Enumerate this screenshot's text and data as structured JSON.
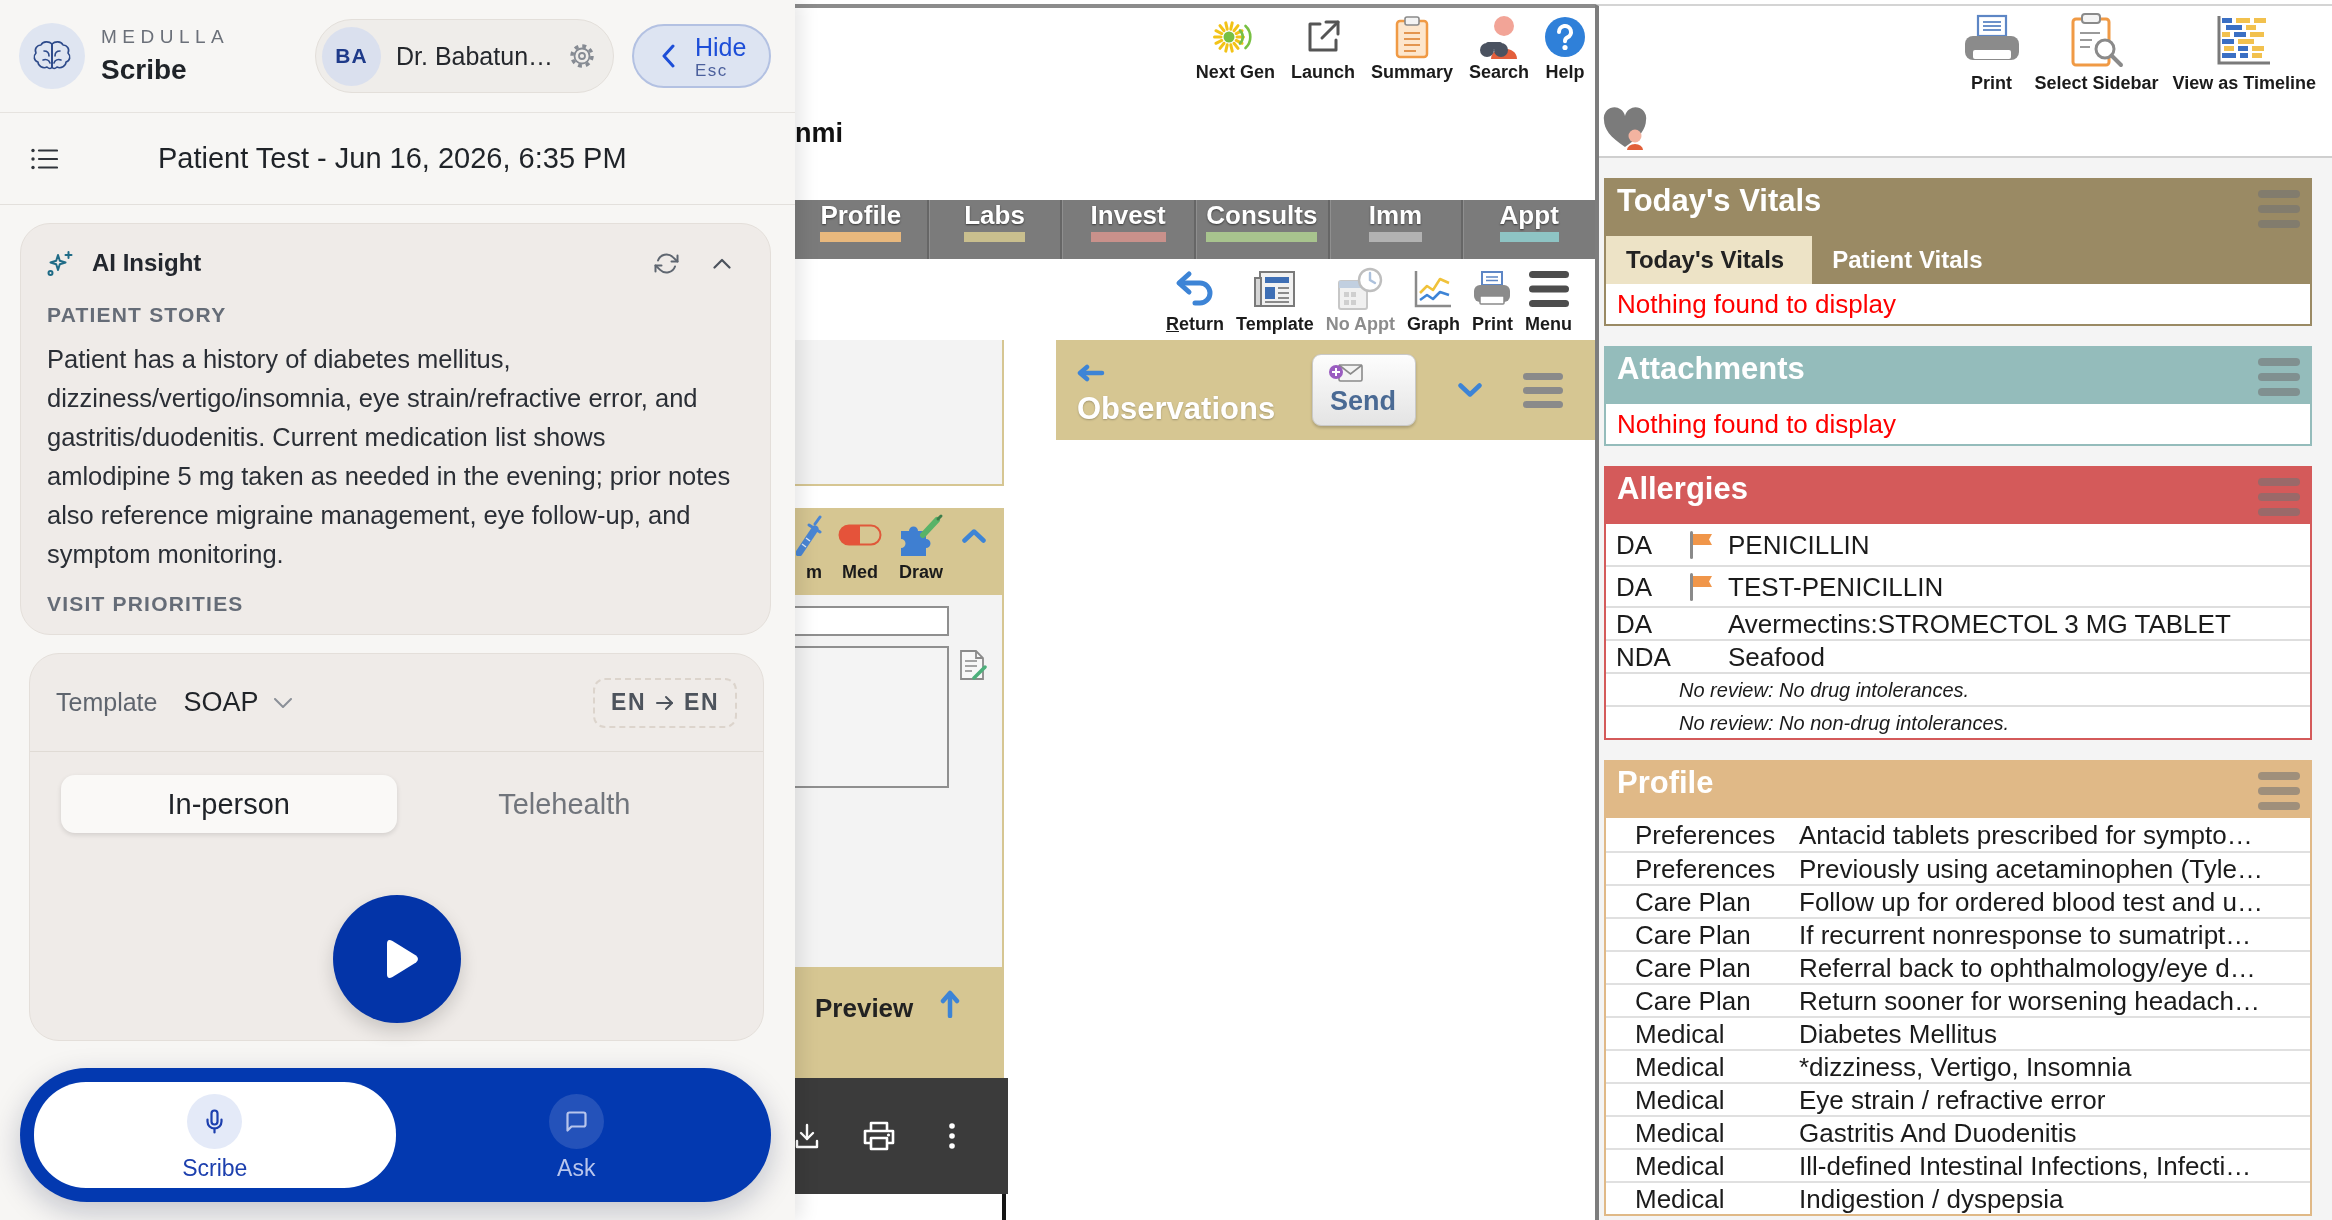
{
  "scribe": {
    "brand": {
      "company": "MEDULLA",
      "product": "Scribe"
    },
    "user": {
      "initials": "BA",
      "name": "Dr. Babatun…"
    },
    "hide_button": {
      "label": "Hide",
      "shortcut": "Esc"
    },
    "session_title": "Patient Test - Jun 16, 2026, 6:35 PM",
    "insight": {
      "title": "AI Insight",
      "expanded": true,
      "sections": [
        {
          "heading": "PATIENT STORY",
          "text": "Patient has a history of diabetes mellitus, dizziness/vertigo/insomnia, eye strain/refractive error, and gastritis/duodenitis. Current medication list shows amlodipine 5 mg taken as needed in the evening; prior notes also reference migraine management, eye follow-up, and symptom monitoring."
        },
        {
          "heading": "VISIT PRIORITIES"
        }
      ]
    },
    "recorder": {
      "template_label": "Template",
      "template": "SOAP",
      "source_language": "EN",
      "target_language": "EN",
      "modes": [
        {
          "label": "In-person",
          "selected": true
        },
        {
          "label": "Telehealth",
          "selected": false
        }
      ]
    },
    "nav": [
      {
        "label": "Scribe",
        "selected": true
      },
      {
        "label": "Ask",
        "selected": false
      }
    ]
  },
  "emr": {
    "header_tools": [
      "Next Gen",
      "Launch",
      "Summary",
      "Search",
      "Help"
    ],
    "patient_name": "nmi",
    "tabs": [
      {
        "label": "Profile",
        "color": "#e8b87d",
        "selected": false
      },
      {
        "label": "Labs",
        "color": "#c9bf8e",
        "selected": false
      },
      {
        "label": "Invest",
        "color": "#c9918b",
        "selected": false
      },
      {
        "label": "Consults",
        "color": "#a8c48e",
        "selected": false
      },
      {
        "label": "Imm",
        "color": "#b2b2b2",
        "selected": false
      },
      {
        "label": "Appt",
        "color": "#8ec4c4",
        "selected": false
      }
    ],
    "toolbar": [
      {
        "label": "Return",
        "disabled": false,
        "access_key": true
      },
      {
        "label": "Template",
        "disabled": false,
        "access_key": false
      },
      {
        "label": "No Appt",
        "disabled": true,
        "access_key": false
      },
      {
        "label": "Graph",
        "disabled": false,
        "access_key": false
      },
      {
        "label": "Print",
        "disabled": false,
        "access_key": false
      },
      {
        "label": "Menu",
        "disabled": false,
        "access_key": false
      }
    ],
    "clinical_tools": [
      "m",
      "Med",
      "Draw"
    ],
    "preview": {
      "title": "Preview"
    },
    "observations": {
      "title": "Observations",
      "send_label": "Send"
    }
  },
  "sidebar": {
    "tools": [
      "Print",
      "Select Sidebar",
      "View as Timeline"
    ],
    "panels": [
      {
        "kind": "vitals",
        "title": "Today's Vitals",
        "color": "#9a8a64",
        "tabs": [
          {
            "label": "Today's Vitals",
            "selected": true
          },
          {
            "label": "Patient Vitals",
            "selected": false
          }
        ],
        "empty_message": "Nothing found to display"
      },
      {
        "kind": "attachments",
        "title": "Attachments",
        "color": "#94bcbb",
        "empty_message": "Nothing found to display"
      },
      {
        "kind": "allergies",
        "title": "Allergies",
        "color": "#d45a5a",
        "rows": [
          {
            "type": "DA",
            "flagged": true,
            "name": "PENICILLIN"
          },
          {
            "type": "DA",
            "flagged": true,
            "name": "TEST-PENICILLIN"
          },
          {
            "type": "DA",
            "flagged": false,
            "name": "Avermectins:STROMECTOL 3 MG TABLET"
          },
          {
            "type": "NDA",
            "flagged": false,
            "name": "Seafood"
          }
        ],
        "notes": [
          "No review: No drug intolerances.",
          "No review: No non-drug intolerances."
        ]
      },
      {
        "kind": "profile",
        "title": "Profile",
        "color": "#e0b987",
        "rows": [
          {
            "category": "Preferences",
            "description": "Antacid tablets prescribed for sympto…"
          },
          {
            "category": "Preferences",
            "description": "Previously using acetaminophen (Tyle…"
          },
          {
            "category": "Care Plan",
            "description": "Follow up for ordered blood test and u…"
          },
          {
            "category": "Care Plan",
            "description": "If recurrent nonresponse to sumatript…"
          },
          {
            "category": "Care Plan",
            "description": "Referral back to ophthalmology/eye d…"
          },
          {
            "category": "Care Plan",
            "description": "Return sooner for worsening headach…"
          },
          {
            "category": "Medical",
            "description": "Diabetes Mellitus"
          },
          {
            "category": "Medical",
            "description": "*dizziness, Vertigo, Insomnia"
          },
          {
            "category": "Medical",
            "description": "Eye strain / refractive error"
          },
          {
            "category": "Medical",
            "description": "Gastritis And Duodenitis"
          },
          {
            "category": "Medical",
            "description": "Ill-defined Intestinal Infections, Infecti…"
          },
          {
            "category": "Medical",
            "description": "Indigestion / dyspepsia"
          }
        ]
      }
    ]
  }
}
